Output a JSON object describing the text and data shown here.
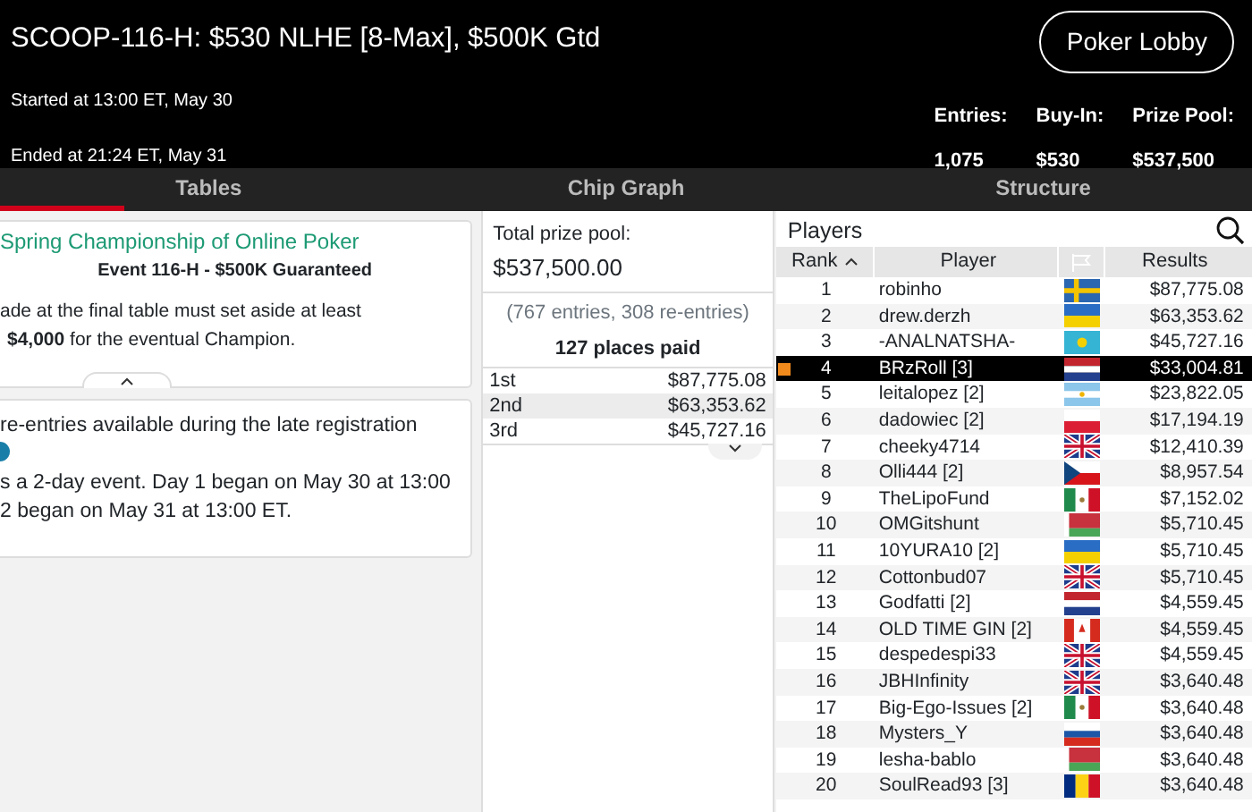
{
  "header": {
    "title": "SCOOP-116-H: $530 NLHE [8-Max], $500K Gtd",
    "started": "Started at 13:00 ET, May 30",
    "ended": "Ended at 21:24 ET, May 31",
    "lobby_button": "Poker Lobby",
    "stats": [
      {
        "label": "Entries:",
        "value": "1,075"
      },
      {
        "label": "Buy-In:",
        "value": "$530"
      },
      {
        "label": "Prize Pool:",
        "value": "$537,500"
      }
    ]
  },
  "tabs": [
    {
      "label": "Tables",
      "selected": true
    },
    {
      "label": "Chip Graph",
      "selected": false
    },
    {
      "label": "Structure",
      "selected": false
    }
  ],
  "info_cards": [
    {
      "title": "Spring Championship of Online Poker",
      "subtitle": "Event 116-H - $500K Guaranteed",
      "lines": [
        "ade at the final table must set aside at least",
        "**$4,000** for the eventual Champion."
      ]
    },
    {
      "lines": [
        "re-entries available during the late registration",
        "s a 2-day event. Day 1 began on May 30 at 13:00",
        "2 began on May 31 at 13:00 ET."
      ]
    }
  ],
  "prize_panel": {
    "label": "Total prize pool:",
    "amount": "$537,500.00",
    "entries": "(767 entries, 308 re-entries)",
    "places": "127 places paid",
    "payouts": [
      {
        "place": "1st",
        "amount": "$87,775.08"
      },
      {
        "place": "2nd",
        "amount": "$63,353.62"
      },
      {
        "place": "3rd",
        "amount": "$45,727.16"
      }
    ]
  },
  "players": {
    "title": "Players",
    "columns": [
      "Rank",
      "Player",
      "Results"
    ],
    "rows": [
      {
        "rank": "1",
        "player": "robinho",
        "kind": "se",
        "result": "$87,775.08",
        "selected": false
      },
      {
        "rank": "2",
        "player": "drew.derzh",
        "kind": "ua",
        "result": "$63,353.62",
        "selected": false
      },
      {
        "rank": "3",
        "player": "-ANALNATSHA-",
        "kind": "kz",
        "result": "$45,727.16",
        "selected": false
      },
      {
        "rank": "4",
        "player": "BRzRoll [3]",
        "kind": "nl",
        "result": "$33,004.81",
        "selected": true
      },
      {
        "rank": "5",
        "player": "leitalopez [2]",
        "kind": "ar",
        "result": "$23,822.05",
        "selected": false
      },
      {
        "rank": "6",
        "player": "dadowiec [2]",
        "kind": "pl",
        "result": "$17,194.19",
        "selected": false
      },
      {
        "rank": "7",
        "player": "cheeky4714",
        "kind": "gb",
        "result": "$12,410.39",
        "selected": false
      },
      {
        "rank": "8",
        "player": "Olli444 [2]",
        "kind": "cz",
        "result": "$8,957.54",
        "selected": false
      },
      {
        "rank": "9",
        "player": "TheLipoFund",
        "kind": "mx",
        "result": "$7,152.02",
        "selected": false
      },
      {
        "rank": "10",
        "player": "OMGitshunt",
        "kind": "by",
        "result": "$5,710.45",
        "selected": false
      },
      {
        "rank": "11",
        "player": "10YURA10 [2]",
        "kind": "ua",
        "result": "$5,710.45",
        "selected": false
      },
      {
        "rank": "12",
        "player": "Cottonbud07",
        "kind": "gb",
        "result": "$5,710.45",
        "selected": false
      },
      {
        "rank": "13",
        "player": "Godfatti [2]",
        "kind": "nl",
        "result": "$4,559.45",
        "selected": false
      },
      {
        "rank": "14",
        "player": "OLD TIME GIN [2]",
        "kind": "ca",
        "result": "$4,559.45",
        "selected": false
      },
      {
        "rank": "15",
        "player": "despedespi33",
        "kind": "gb",
        "result": "$4,559.45",
        "selected": false
      },
      {
        "rank": "16",
        "player": "JBHInfinity",
        "kind": "gb",
        "result": "$3,640.48",
        "selected": false
      },
      {
        "rank": "17",
        "player": "Big-Ego-Issues [2]",
        "kind": "mx",
        "result": "$3,640.48",
        "selected": false
      },
      {
        "rank": "18",
        "player": "Mysters_Y",
        "kind": "ru",
        "result": "$3,640.48",
        "selected": false
      },
      {
        "rank": "19",
        "player": "lesha-bablo",
        "kind": "by",
        "result": "$3,640.48",
        "selected": false
      },
      {
        "rank": "20",
        "player": "SoulRead93 [3]",
        "kind": "ro",
        "result": "$3,640.48",
        "selected": false
      }
    ]
  }
}
